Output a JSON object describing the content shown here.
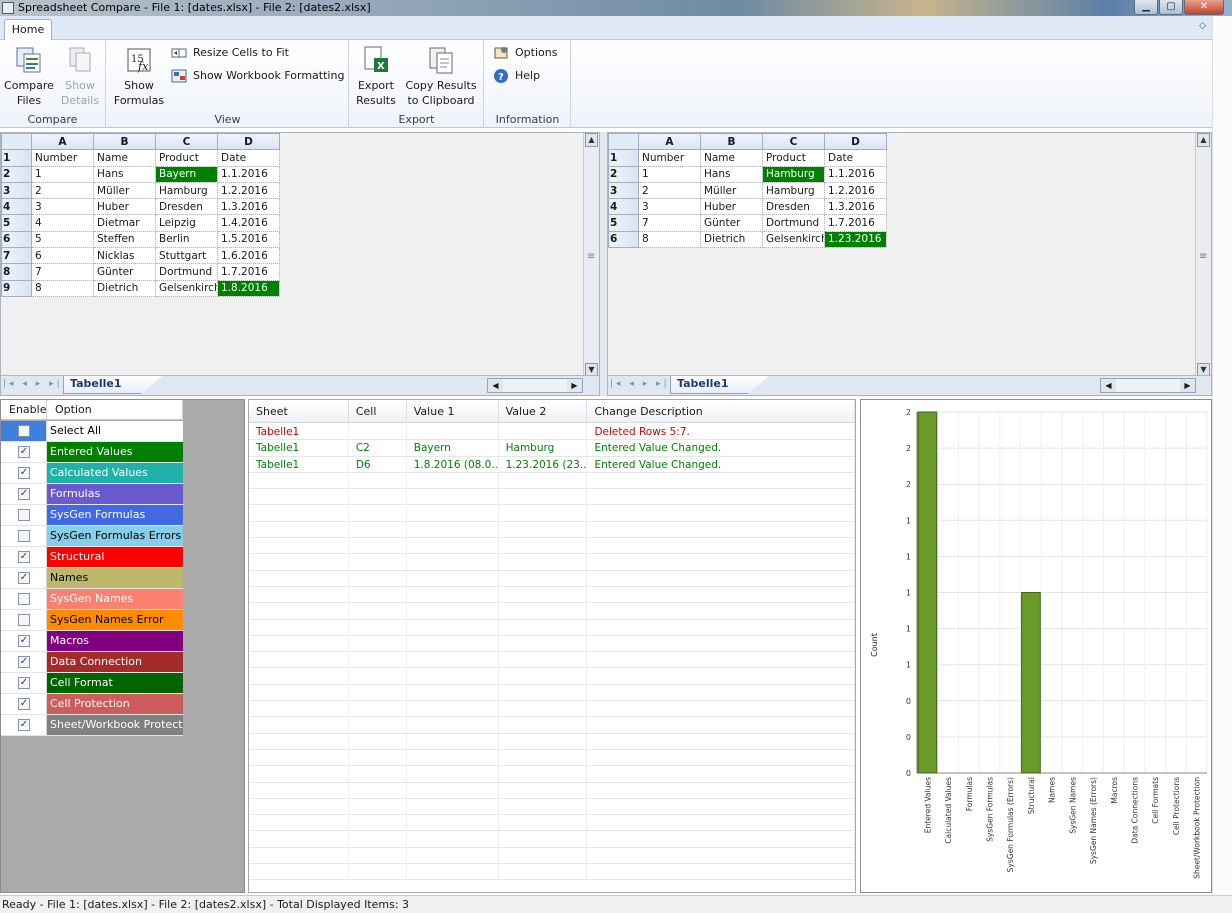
{
  "window": {
    "title": "Spreadsheet Compare - File 1: [dates.xlsx] - File 2: [dates2.xlsx]"
  },
  "ribbon": {
    "tab": "Home",
    "groups": {
      "compare": {
        "label": "Compare",
        "compare_files": [
          "Compare",
          "Files"
        ],
        "show_details": [
          "Show",
          "Details"
        ]
      },
      "view": {
        "label": "View",
        "show_formulas": [
          "Show",
          "Formulas"
        ],
        "resize_cells": "Resize Cells to Fit",
        "show_workbook_formatting": "Show Workbook Formatting"
      },
      "export": {
        "label": "Export",
        "export_results": [
          "Export",
          "Results"
        ],
        "copy_results": [
          "Copy Results",
          "to Clipboard"
        ]
      },
      "information": {
        "label": "Information",
        "options": "Options",
        "help": "Help"
      }
    }
  },
  "left_sheet": {
    "tab": "Tabelle1",
    "columns": [
      "A",
      "B",
      "C",
      "D"
    ],
    "rows": [
      {
        "n": "1",
        "cells": [
          "Number",
          "Name",
          "Product",
          "Date"
        ],
        "diff": []
      },
      {
        "n": "2",
        "cells": [
          "1",
          "Hans",
          "Bayern",
          "1.1.2016"
        ],
        "diff": [
          2
        ]
      },
      {
        "n": "3",
        "cells": [
          "2",
          "Müller",
          "Hamburg",
          "1.2.2016"
        ],
        "diff": []
      },
      {
        "n": "4",
        "cells": [
          "3",
          "Huber",
          "Dresden",
          "1.3.2016"
        ],
        "diff": []
      },
      {
        "n": "5",
        "cells": [
          "4",
          "Dietmar",
          "Leipzig",
          "1.4.2016"
        ],
        "diff": []
      },
      {
        "n": "6",
        "cells": [
          "5",
          "Steffen",
          "Berlin",
          "1.5.2016"
        ],
        "diff": []
      },
      {
        "n": "7",
        "cells": [
          "6",
          "Nicklas",
          "Stuttgart",
          "1.6.2016"
        ],
        "diff": []
      },
      {
        "n": "8",
        "cells": [
          "7",
          "Günter",
          "Dortmund",
          "1.7.2016"
        ],
        "diff": []
      },
      {
        "n": "9",
        "cells": [
          "8",
          "Dietrich",
          "Gelsenkirch",
          "1.8.2016"
        ],
        "diff": [
          3
        ]
      }
    ]
  },
  "right_sheet": {
    "tab": "Tabelle1",
    "columns": [
      "A",
      "B",
      "C",
      "D"
    ],
    "rows": [
      {
        "n": "1",
        "cells": [
          "Number",
          "Name",
          "Product",
          "Date"
        ],
        "diff": []
      },
      {
        "n": "2",
        "cells": [
          "1",
          "Hans",
          "Hamburg",
          "1.1.2016"
        ],
        "diff": [
          2
        ]
      },
      {
        "n": "3",
        "cells": [
          "2",
          "Müller",
          "Hamburg",
          "1.2.2016"
        ],
        "diff": []
      },
      {
        "n": "4",
        "cells": [
          "3",
          "Huber",
          "Dresden",
          "1.3.2016"
        ],
        "diff": []
      },
      {
        "n": "5",
        "cells": [
          "7",
          "Günter",
          "Dortmund",
          "1.7.2016"
        ],
        "diff": []
      },
      {
        "n": "6",
        "cells": [
          "8",
          "Dietrich",
          "Gelsenkirch",
          "1.23.2016"
        ],
        "diff": [
          3
        ]
      }
    ]
  },
  "options": {
    "headers": [
      "Enable",
      "Option"
    ],
    "items": [
      {
        "label": "Select All",
        "checked": false,
        "bg": "#ffffff",
        "fg": "#000000"
      },
      {
        "label": "Entered Values",
        "checked": true,
        "bg": "#008000",
        "fg": "#ffffff"
      },
      {
        "label": "Calculated Values",
        "checked": true,
        "bg": "#20b2aa",
        "fg": "#ffffff"
      },
      {
        "label": "Formulas",
        "checked": true,
        "bg": "#6a5acd",
        "fg": "#ffffff"
      },
      {
        "label": "SysGen Formulas",
        "checked": false,
        "bg": "#4169e1",
        "fg": "#ffffff"
      },
      {
        "label": "SysGen Formulas Errors",
        "checked": false,
        "bg": "#87ceeb",
        "fg": "#000000"
      },
      {
        "label": "Structural",
        "checked": true,
        "bg": "#ff0000",
        "fg": "#ffffff"
      },
      {
        "label": "Names",
        "checked": true,
        "bg": "#bdb76b",
        "fg": "#000000"
      },
      {
        "label": "SysGen Names",
        "checked": false,
        "bg": "#fa8072",
        "fg": "#ffffff"
      },
      {
        "label": "SysGen Names Error",
        "checked": false,
        "bg": "#ff8c00",
        "fg": "#000000"
      },
      {
        "label": "Macros",
        "checked": true,
        "bg": "#800080",
        "fg": "#ffffff"
      },
      {
        "label": "Data Connection",
        "checked": true,
        "bg": "#a52a2a",
        "fg": "#ffffff"
      },
      {
        "label": "Cell Format",
        "checked": true,
        "bg": "#006400",
        "fg": "#ffffff"
      },
      {
        "label": "Cell Protection",
        "checked": true,
        "bg": "#cd5c5c",
        "fg": "#ffffff"
      },
      {
        "label": "Sheet/Workbook Protection",
        "checked": true,
        "bg": "#808080",
        "fg": "#ffffff"
      }
    ]
  },
  "results": {
    "headers": [
      "Sheet",
      "Cell",
      "Value 1",
      "Value 2",
      "Change Description"
    ],
    "rows": [
      {
        "cells": [
          "Tabelle1",
          "",
          "",
          "",
          "Deleted Rows 5:7."
        ],
        "color": "#cc0000"
      },
      {
        "cells": [
          "Tabelle1",
          "C2",
          "Bayern",
          "Hamburg",
          "Entered Value Changed."
        ],
        "color": "#008000"
      },
      {
        "cells": [
          "Tabelle1",
          "D6",
          "1.8.2016 (08.0...",
          "1.23.2016 (23....",
          "Entered Value Changed."
        ],
        "color": "#008000"
      }
    ]
  },
  "chart_data": {
    "type": "bar",
    "ylabel": "Count",
    "ytick_labels": [
      "2",
      "2",
      "2",
      "1",
      "1",
      "1",
      "1",
      "1",
      "0",
      "0",
      "0"
    ],
    "ylim": [
      0,
      2
    ],
    "categories": [
      "Entered Values",
      "Calculated Values",
      "Formulas",
      "SysGen Formulas",
      "SysGen Formulas (Errors)",
      "Structural",
      "Names",
      "SysGen Names",
      "SysGen Names (Errors)",
      "Macros",
      "Data Connections",
      "Cell Formats",
      "Cell Protections",
      "Sheet/Workbook Protection"
    ],
    "values": [
      2,
      0,
      0,
      0,
      0,
      1,
      0,
      0,
      0,
      0,
      0,
      0,
      0,
      0
    ],
    "bar_color": "#6a9a2a",
    "grid": true
  },
  "status": "Ready - File 1: [dates.xlsx] - File 2: [dates2.xlsx] - Total Displayed Items: 3"
}
